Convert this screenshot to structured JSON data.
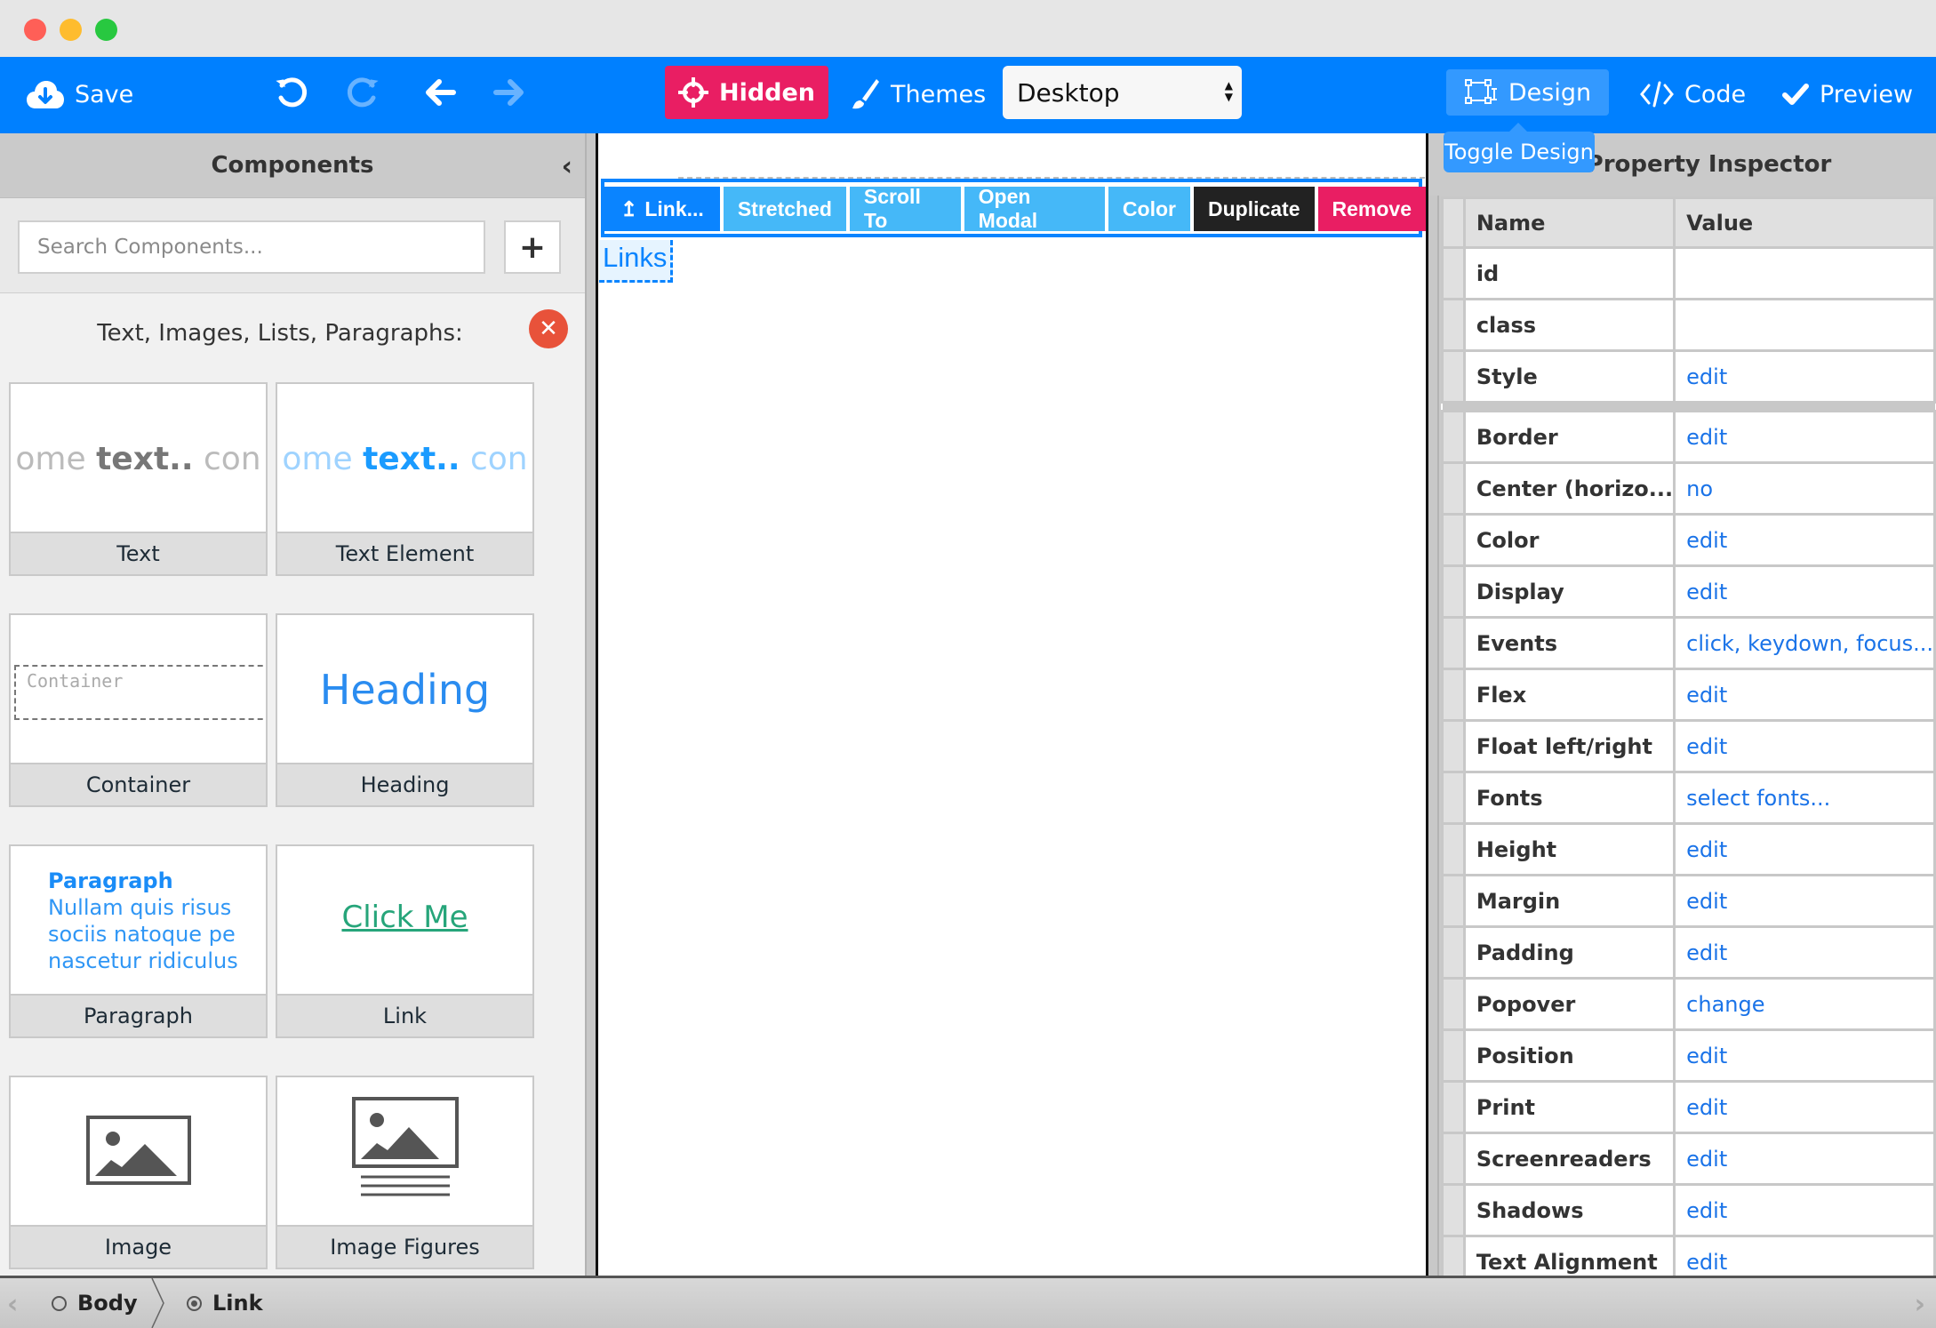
{
  "window": {
    "controls": [
      "close",
      "minimize",
      "maximize"
    ]
  },
  "toolbar": {
    "save_label": "Save",
    "save_icon": "cloud-download-icon",
    "undo_icon": "undo-icon",
    "redo_icon": "redo-icon",
    "back_icon": "arrow-left-icon",
    "forward_icon": "arrow-right-icon",
    "hidden_label": "Hidden",
    "themes_label": "Themes",
    "device_selected": "Desktop",
    "design_label": "Design",
    "code_label": "Code",
    "preview_label": "Preview",
    "design_tooltip": "Toggle Design",
    "colors": {
      "bar": "#0080ff",
      "hidden_button": "#e91e63",
      "design_active": "#3399ff"
    }
  },
  "left_panel": {
    "title": "Components",
    "search_placeholder": "Search Components...",
    "add_label": "+",
    "category_title": "Text, Images, Lists, Paragraphs:",
    "components": [
      {
        "label": "Text",
        "preview": {
          "prefix": "ome ",
          "bold": "text..",
          "suffix": " con"
        }
      },
      {
        "label": "Text Element",
        "preview": {
          "prefix": "ome ",
          "bold": "text..",
          "suffix": " con"
        }
      },
      {
        "label": "Container",
        "preview": {
          "text": "Container"
        }
      },
      {
        "label": "Heading",
        "preview": {
          "text": "Heading"
        }
      },
      {
        "label": "Paragraph",
        "preview": {
          "title": "Paragraph",
          "lines": [
            "Nullam quis risus",
            "sociis natoque pe",
            "nascetur ridiculus"
          ]
        }
      },
      {
        "label": "Link",
        "preview": {
          "text": "Click Me"
        }
      },
      {
        "label": "Image",
        "preview": {
          "icon": "image-icon"
        }
      },
      {
        "label": "Image Figures",
        "preview": {
          "icon": "image-figure-icon"
        }
      }
    ]
  },
  "canvas": {
    "element_toolbar": [
      {
        "label": "Link...",
        "style": "primary",
        "icon": "select-parent-icon"
      },
      {
        "label": "Stretched",
        "style": "light"
      },
      {
        "label": "Scroll To",
        "style": "light"
      },
      {
        "label": "Open Modal",
        "style": "light"
      },
      {
        "label": "Color",
        "style": "light"
      },
      {
        "label": "Duplicate",
        "style": "dark"
      },
      {
        "label": "Remove",
        "style": "danger"
      }
    ],
    "selected_element_text": "Links"
  },
  "inspector": {
    "title": "Property Inspector",
    "columns": [
      "Name",
      "Value"
    ],
    "rows_top": [
      {
        "name": "id",
        "value": ""
      },
      {
        "name": "class",
        "value": ""
      },
      {
        "name": "Style",
        "value": "edit"
      }
    ],
    "rows": [
      {
        "name": "Border",
        "value": "edit"
      },
      {
        "name": "Center (horizo...",
        "value": "no"
      },
      {
        "name": "Color",
        "value": "edit"
      },
      {
        "name": "Display",
        "value": "edit"
      },
      {
        "name": "Events",
        "value": "click, keydown, focus..."
      },
      {
        "name": "Flex",
        "value": "edit"
      },
      {
        "name": "Float left/right",
        "value": "edit"
      },
      {
        "name": "Fonts",
        "value": "select fonts..."
      },
      {
        "name": "Height",
        "value": "edit"
      },
      {
        "name": "Margin",
        "value": "edit"
      },
      {
        "name": "Padding",
        "value": "edit"
      },
      {
        "name": "Popover",
        "value": "change"
      },
      {
        "name": "Position",
        "value": "edit"
      },
      {
        "name": "Print",
        "value": "edit"
      },
      {
        "name": "Screenreaders",
        "value": "edit"
      },
      {
        "name": "Shadows",
        "value": "edit"
      },
      {
        "name": "Text Alignment",
        "value": "edit"
      }
    ]
  },
  "breadcrumb": {
    "items": [
      {
        "label": "Body",
        "selected": false
      },
      {
        "label": "Link",
        "selected": true
      }
    ]
  }
}
